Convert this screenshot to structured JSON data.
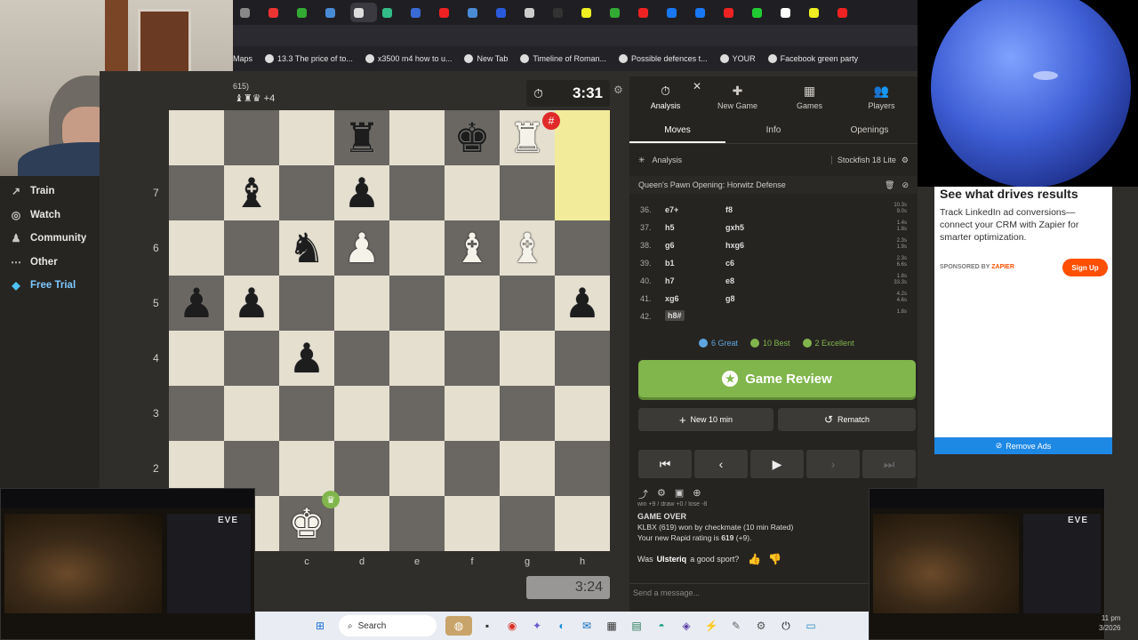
{
  "browser": {
    "bookmarks": [
      {
        "label": "Maps",
        "icon": "map-icon"
      },
      {
        "label": "13.3 The price of to...",
        "icon": "page-icon"
      },
      {
        "label": "x3500 m4 how to u...",
        "icon": "google-icon"
      },
      {
        "label": "New Tab",
        "icon": "page-icon"
      },
      {
        "label": "Timeline of Roman...",
        "icon": "w-icon"
      },
      {
        "label": "Possible defences t...",
        "icon": "cl-icon"
      },
      {
        "label": "YOUR",
        "icon": "facebook-icon"
      },
      {
        "label": "Facebook green party",
        "icon": "facebook-icon"
      }
    ]
  },
  "sidebar": {
    "items": [
      {
        "label": "Train",
        "icon": "train-icon"
      },
      {
        "label": "Watch",
        "icon": "binoculars-icon"
      },
      {
        "label": "Community",
        "icon": "community-icon"
      },
      {
        "label": "Other",
        "icon": "more-icon"
      },
      {
        "label": "Free Trial",
        "icon": "diamond-icon"
      }
    ]
  },
  "game": {
    "opponent_rating": "615)",
    "opponent_material": "+4",
    "clock_top": "3:31",
    "clock_bottom": "3:24",
    "ranks": [
      "7",
      "6",
      "5",
      "4",
      "3",
      "2"
    ],
    "files": [
      "c",
      "d",
      "e",
      "f",
      "g",
      "h"
    ],
    "board": [
      [
        "",
        "",
        "",
        "br",
        "",
        "bk",
        "wr",
        ""
      ],
      [
        "",
        "bb",
        "",
        "bp",
        "",
        "",
        "",
        ""
      ],
      [
        "",
        "",
        "bn",
        "wp",
        "",
        "wb",
        "wb",
        ""
      ],
      [
        "bp",
        "bp",
        "",
        "",
        "",
        "",
        "",
        "bp"
      ],
      [
        "",
        "",
        "bp",
        "",
        "",
        "",
        "",
        ""
      ],
      [
        "",
        "",
        "",
        "",
        "",
        "",
        "",
        ""
      ],
      [
        "",
        "",
        "",
        "",
        "",
        "",
        "",
        ""
      ],
      [
        "",
        "",
        "wk",
        "",
        "",
        "",
        "",
        ""
      ]
    ]
  },
  "panel": {
    "tabs": [
      {
        "label": "Analysis",
        "icon": "stopwatch-icon"
      },
      {
        "label": "New Game",
        "icon": "plus-icon"
      },
      {
        "label": "Games",
        "icon": "board-icon"
      },
      {
        "label": "Players",
        "icon": "players-icon"
      }
    ],
    "subtabs": [
      "Moves",
      "Info",
      "Openings"
    ],
    "analysis_label": "Analysis",
    "engine": "Stockfish 18 Lite",
    "opening": "Queen's Pawn Opening: Horwitz Defense",
    "moves": [
      {
        "n": "36.",
        "w": "e7+",
        "b": "f8",
        "t": [
          "10.3s",
          "9.0s"
        ]
      },
      {
        "n": "37.",
        "w": "h5",
        "b": "gxh5",
        "t": [
          "1.4s",
          "1.8s"
        ]
      },
      {
        "n": "38.",
        "w": "g6",
        "b": "hxg6",
        "t": [
          "2.3s",
          "1.9s"
        ]
      },
      {
        "n": "39.",
        "w": "b1",
        "b": "c6",
        "t": [
          "2.3s",
          "6.6s"
        ]
      },
      {
        "n": "40.",
        "w": "h7",
        "b": "e8",
        "t": [
          "1.8s",
          "33.3s"
        ]
      },
      {
        "n": "41.",
        "w": "xg6",
        "b": "g8",
        "t": [
          "4.2s",
          "4.6s"
        ]
      },
      {
        "n": "42.",
        "w": "h8#",
        "b": "",
        "t": [
          "1.8s",
          ""
        ]
      }
    ],
    "stats": [
      {
        "label": "6 Great",
        "color": "#5ea5e0"
      },
      {
        "label": "10 Best",
        "color": "#81b64c"
      },
      {
        "label": "2 Excellent",
        "color": "#81b64c"
      }
    ],
    "review_button": "Game Review",
    "new_button": "New 10 min",
    "rematch_button": "Rematch",
    "chat": {
      "truncated": "win +9 / draw +0 / lose -8",
      "game_over": "GAME OVER",
      "result": "KLBX (619) won by checkmate (10 min Rated)",
      "rating_prefix": "Your new Rapid rating is ",
      "rating_value": "619",
      "rating_suffix": " (+9).",
      "sport_prefix": "Was ",
      "sport_name": "Ulsteriq",
      "sport_suffix": " a good sport?",
      "placeholder": "Send a message..."
    }
  },
  "ad": {
    "headline": "See what drives results",
    "body": "Track LinkedIn ad conversions—connect your CRM with Zapier for smarter optimization.",
    "sponsored": "SPONSORED BY",
    "sponsor": "ZAPIER",
    "cta": "Sign Up",
    "remove": "Remove Ads"
  },
  "videos": {
    "logo": "EVE"
  },
  "taskbar": {
    "search": "Search",
    "time": "11 pm",
    "date": "3/2026"
  }
}
